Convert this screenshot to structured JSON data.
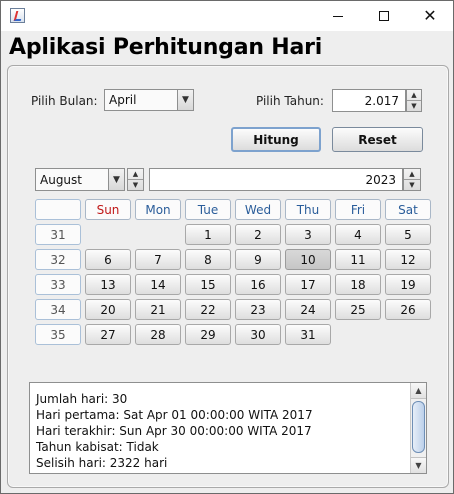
{
  "window": {
    "app_title": "Aplikasi Perhitungan Hari",
    "controls": {
      "minimize": "—",
      "maximize": "☐",
      "close": "✕"
    }
  },
  "form": {
    "month_label": "Pilih Bulan:",
    "month_value": "April",
    "year_label": "Pilih Tahun:",
    "year_value": "2.017",
    "hitung_label": "Hitung",
    "reset_label": "Reset"
  },
  "calendar": {
    "month": "August",
    "year": "2023",
    "weekdays": [
      "Sun",
      "Mon",
      "Tue",
      "Wed",
      "Thu",
      "Fri",
      "Sat"
    ],
    "weeks": [
      {
        "week": "31",
        "days": [
          "",
          "",
          "1",
          "2",
          "3",
          "4",
          "5"
        ]
      },
      {
        "week": "32",
        "days": [
          "6",
          "7",
          "8",
          "9",
          "10",
          "11",
          "12"
        ]
      },
      {
        "week": "33",
        "days": [
          "13",
          "14",
          "15",
          "16",
          "17",
          "18",
          "19"
        ]
      },
      {
        "week": "34",
        "days": [
          "20",
          "21",
          "22",
          "23",
          "24",
          "25",
          "26"
        ]
      },
      {
        "week": "35",
        "days": [
          "27",
          "28",
          "29",
          "30",
          "31",
          "",
          ""
        ]
      }
    ],
    "selected_day": "10"
  },
  "output": {
    "lines": [
      "Jumlah hari: 30",
      "Hari pertama: Sat Apr 01 00:00:00 WITA 2017",
      "Hari terakhir: Sun Apr 30 00:00:00 WITA 2017",
      "Tahun kabisat: Tidak",
      "Selisih hari: 2322 hari"
    ]
  }
}
